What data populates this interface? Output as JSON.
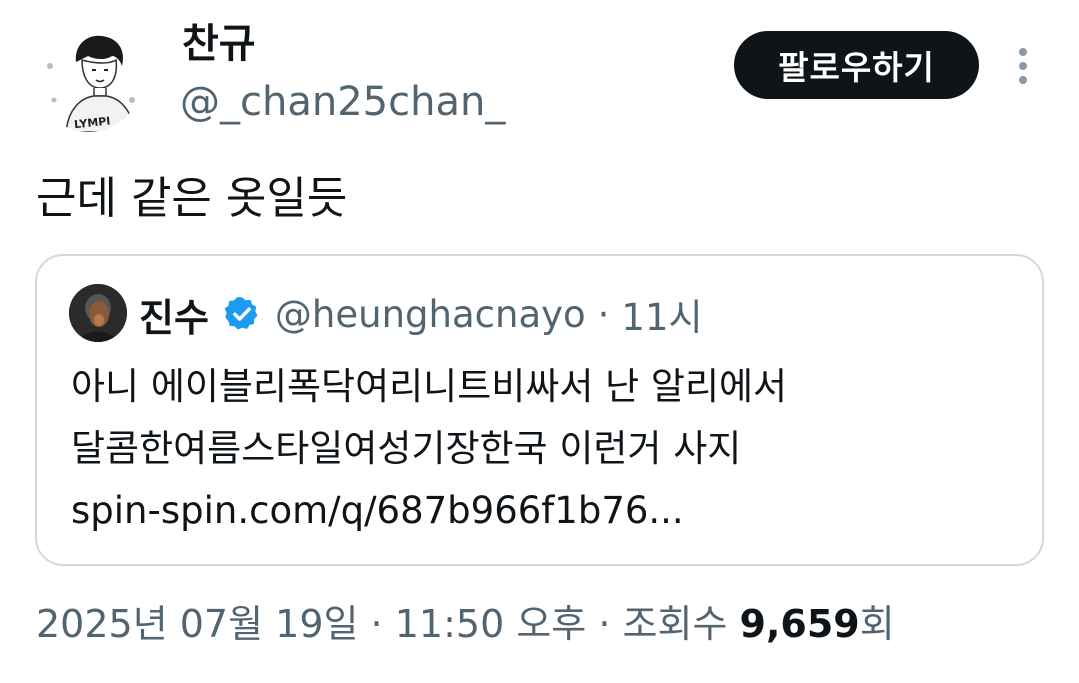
{
  "author": {
    "display_name": "찬규",
    "handle": "@_chan25chan_"
  },
  "follow_button": {
    "label": "팔로우하기"
  },
  "more_icon": "vertical-ellipsis-icon",
  "tweet": {
    "text": "근데 같은 옷일듯"
  },
  "quoted_tweet": {
    "display_name": "진수",
    "verified_icon": "verified-badge-icon",
    "handle": "@heunghacnayo",
    "separator": "·",
    "time": "11시",
    "lines": [
      "아니 에이블리폭닥여리니트비싸서 난 알리에서",
      "달콤한여름스타일여성기장한국 이런거 사지",
      "spin-spin.com/q/687b966f1b76..."
    ]
  },
  "meta": {
    "date": "2025년 07월 19일",
    "sep1": "·",
    "time": "11:50 오후",
    "sep2": "·",
    "views_label": "조회수",
    "views_count": "9,659",
    "views_suffix": "회"
  },
  "colors": {
    "primary_text": "#0f1419",
    "secondary_text": "#536471",
    "border": "#cfd9de",
    "verified_blue": "#1d9bf0",
    "button_bg": "#0f1419"
  }
}
